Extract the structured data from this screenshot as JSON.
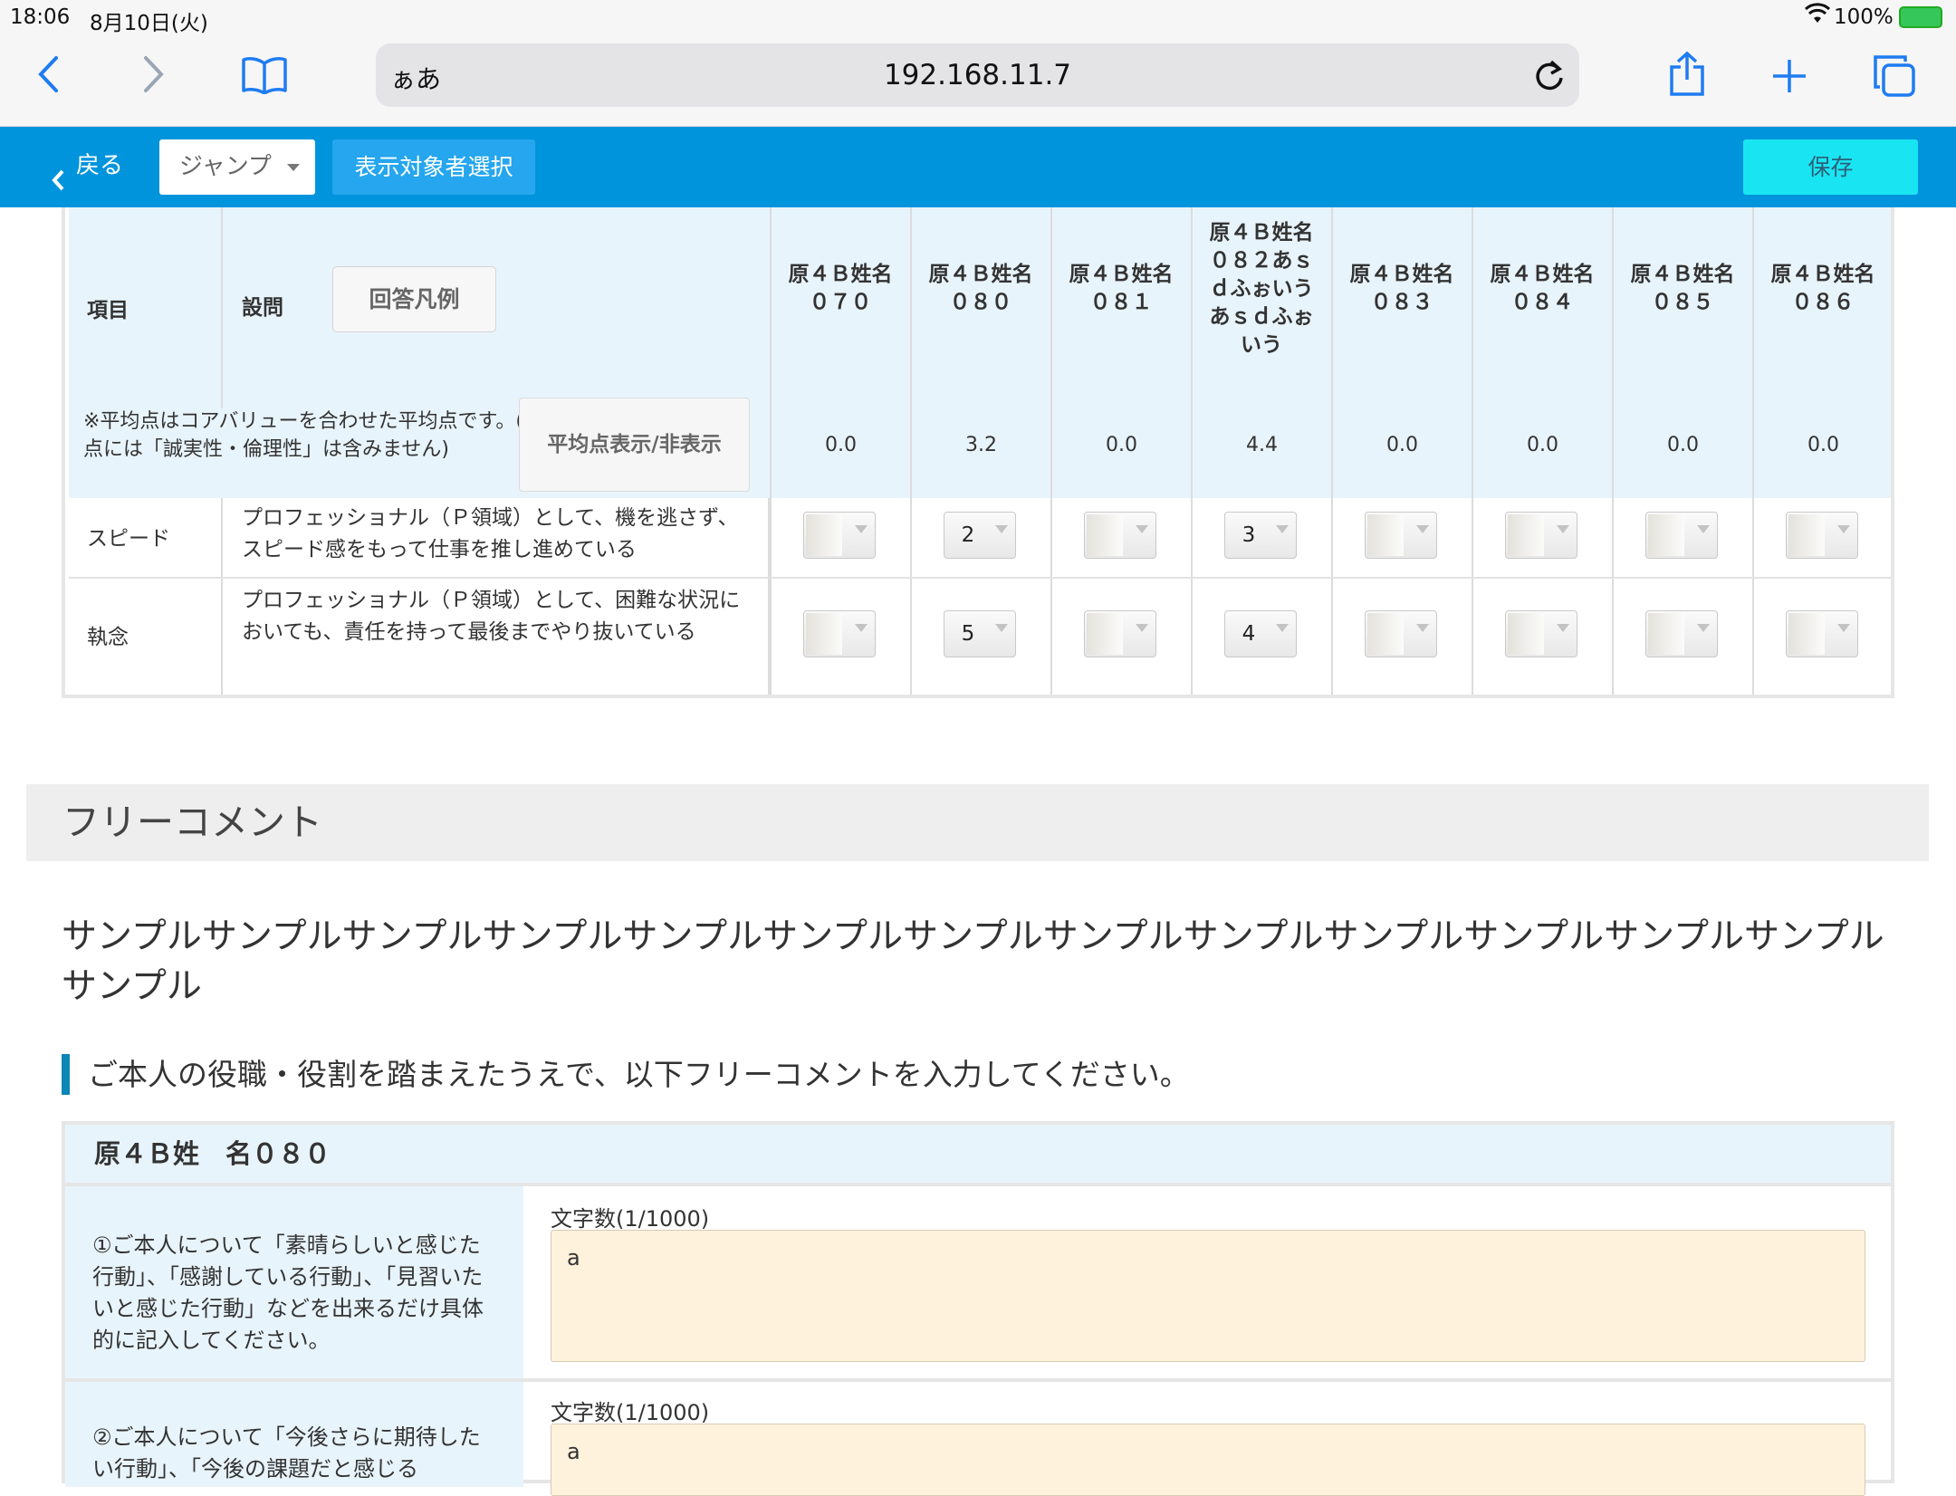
{
  "status_bar": {
    "time": "18:06",
    "date": "8月10日(火)",
    "battery": "100%"
  },
  "browser": {
    "text_size_label": "ぁあ",
    "url": "192.168.11.7"
  },
  "toolbar": {
    "back_label": "戻る",
    "jump_label": "ジャンプ",
    "select_label": "表示対象者選択",
    "save_label": "保存"
  },
  "table": {
    "header_item": "項目",
    "header_question": "設問",
    "legend_button": "回答凡例",
    "avg_note": "※平均点はコアバリューを合わせた平均点です。(平均点には「誠実性・倫理性」は含みません)",
    "avg_toggle": "平均点表示/非表示",
    "persons": [
      {
        "name": "原４Ｂ姓名０７０",
        "avg": "0.0"
      },
      {
        "name": "原４Ｂ姓名０８０",
        "avg": "3.2"
      },
      {
        "name": "原４Ｂ姓名０８１",
        "avg": "0.0"
      },
      {
        "name": "原４Ｂ姓名０８２あｓｄふぉいうあｓｄふぉいう",
        "avg": "4.4"
      },
      {
        "name": "原４Ｂ姓名０８３",
        "avg": "0.0"
      },
      {
        "name": "原４Ｂ姓名０８４",
        "avg": "0.0"
      },
      {
        "name": "原４Ｂ姓名０８５",
        "avg": "0.0"
      },
      {
        "name": "原４Ｂ姓名０８６",
        "avg": "0.0"
      }
    ],
    "rows": [
      {
        "item": "スピード",
        "question": "プロフェッショナル（Ｐ領域）として、機を逃さず、スピード感をもって仕事を推し進めている",
        "values": [
          "",
          "2",
          "",
          "3",
          "",
          "",
          "",
          ""
        ]
      },
      {
        "item": "執念",
        "question": "プロフェッショナル（Ｐ領域）として、困難な状況においても、責任を持って最後までやり抜いている",
        "values": [
          "",
          "5",
          "",
          "4",
          "",
          "",
          "",
          ""
        ]
      }
    ]
  },
  "free_comment": {
    "section_title": "フリーコメント",
    "description": "サンプルサンプルサンプルサンプルサンプルサンプルサンプルサンプルサンプルサンプルサンプルサンプルサンプルサンプル",
    "instruction": "ご本人の役職・役割を踏まえたうえで、以下フリーコメントを入力してください。",
    "person_title": "原４Ｂ姓　名０８０",
    "questions": [
      {
        "question": "①ご本人について「素晴らしいと感じた行動」、「感謝している行動」、「見習いたいと感じた行動」などを出来るだけ具体的に記入してください。",
        "char_count": "文字数(1/1000)",
        "value": "a"
      },
      {
        "question": "②ご本人について「今後さらに期待したい行動」、「今後の課題だと感じる",
        "char_count": "文字数(1/1000)",
        "value": "a"
      }
    ]
  },
  "colors": {
    "appbar": "#0094dc",
    "save": "#19e5f2",
    "header_bg": "#e8f4fb",
    "textarea": "#fff2dc"
  }
}
